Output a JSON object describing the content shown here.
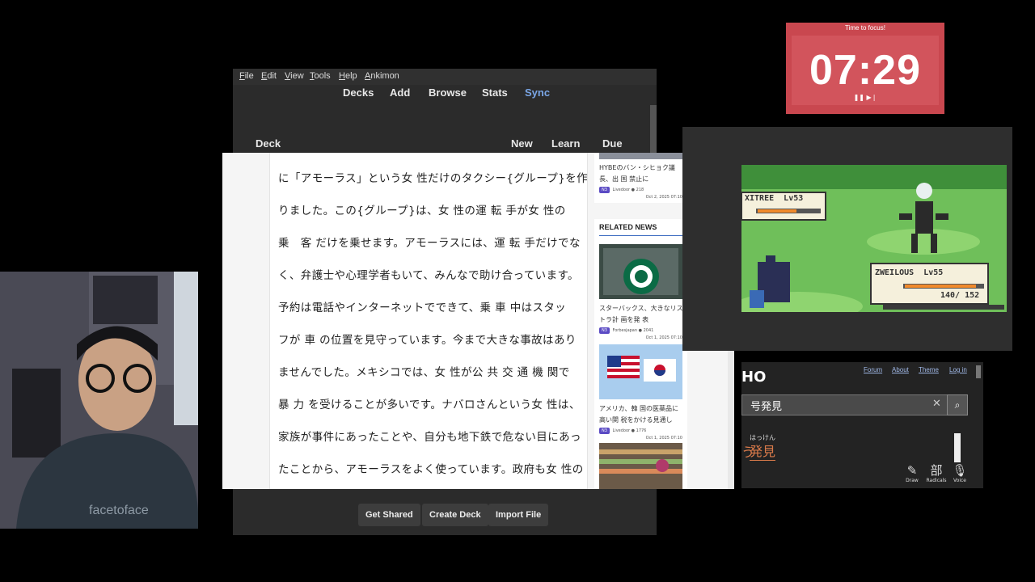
{
  "timer": {
    "label": "Time to focus!",
    "time": "07:29",
    "controls": "❚❚ ▶❘"
  },
  "anki": {
    "menu": [
      "File",
      "Edit",
      "View",
      "Tools",
      "Help",
      "Ankimon"
    ],
    "toolbar": [
      "Decks",
      "Add",
      "Browse",
      "Stats",
      "Sync"
    ],
    "columns": {
      "deck": "Deck",
      "new": "New",
      "learn": "Learn",
      "due": "Due"
    },
    "buttons": [
      "Get Shared",
      "Create Deck",
      "Import File"
    ]
  },
  "article": {
    "lines": [
      "に「アモーラス」という女 性だけのタクシー{グループ}を作",
      "りました。この{グループ}は、女 性の運 転 手が女 性の",
      "乗　客 だけを乗せます。アモーラスには、運 転 手だけでな",
      "く、弁護士や心理学者もいて、みんなで助け合っています。",
      "予約は電話やインターネットでできて、乗 車 中はスタッ",
      "フが 車 の位置を見守っています。今まで大きな事故はあり",
      "ませんでした。メキシコでは、女 性が公 共 交 通 機 関で",
      "暴 力 を受けることが多いです。ナバロさんという女 性は、",
      "家族が事件にあったことや、自分も地下鉄で危ない目にあっ",
      "たことから、アモーラスをよく使っています。政府も女 性の"
    ]
  },
  "sidebar": {
    "top_card": {
      "caption": "HYBEのバン・シヒョク議長、出 国 禁止に",
      "level": "N3",
      "source": "Livedoor",
      "views": "218",
      "date": "Oct 2, 2025 07:10"
    },
    "related_title": "RELATED NEWS",
    "cards": [
      {
        "caption": "スターバックス、大きなリストラ計 画を発 表",
        "level": "N3",
        "source": "Forbesjapan",
        "views": "2041",
        "date": "Oct 1, 2025 07:10"
      },
      {
        "caption": "アメリカ、韓 国の医薬品に高い関 税をかける見通し",
        "level": "N3",
        "source": "Livedoor",
        "views": "1776",
        "date": "Oct 1, 2025 07:10"
      }
    ]
  },
  "game": {
    "enemy": {
      "name": "XITREE",
      "level": "Lv53"
    },
    "player": {
      "name": "ZWEILOUS",
      "level": "Lv55",
      "hp": "140/ 152"
    },
    "colors": {
      "grass": "#6fbf5a",
      "hp_bar": "#f08a2c"
    }
  },
  "dict": {
    "logo": "HO",
    "links": [
      "Forum",
      "About",
      "Theme",
      "Log in"
    ],
    "query": "号発見",
    "result_reading": "はっけん",
    "result_word": "発見",
    "result_prefix": "う",
    "tools": [
      {
        "icon": "✎",
        "label": "Draw"
      },
      {
        "icon": "部",
        "label": "Radicals"
      },
      {
        "icon": "🎙",
        "label": "Voice"
      }
    ]
  }
}
